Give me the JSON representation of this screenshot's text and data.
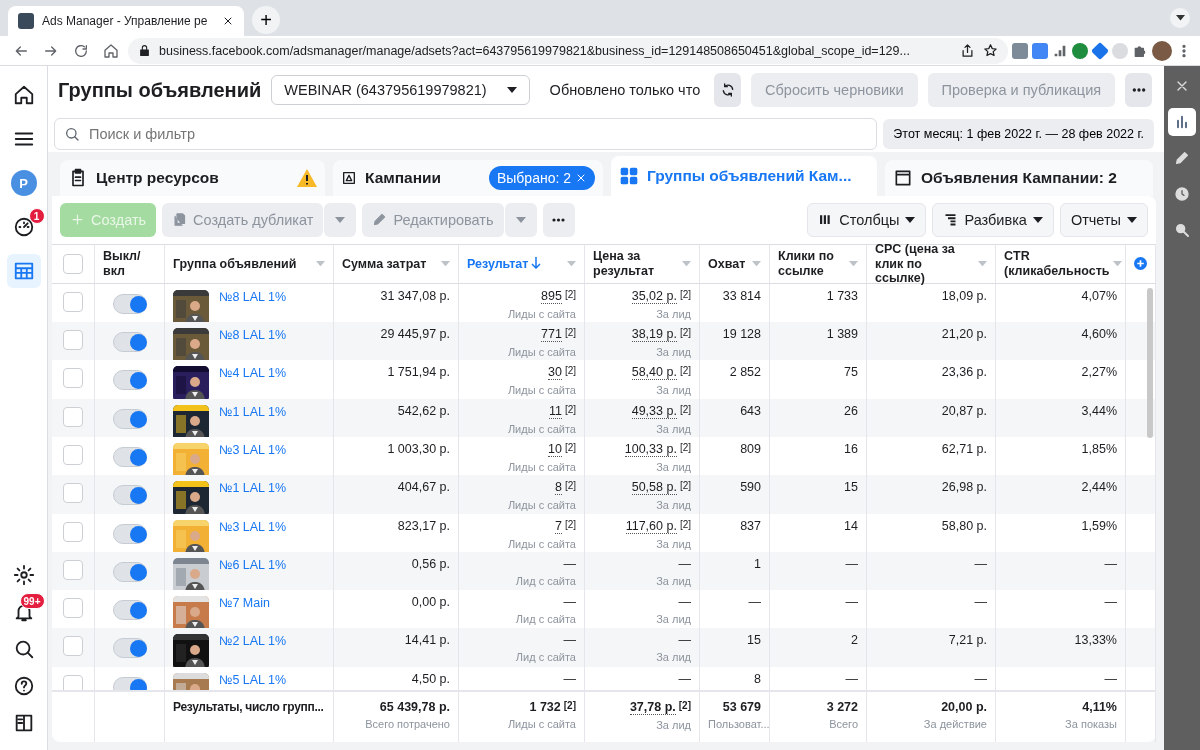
{
  "browser": {
    "tab_title": "Ads Manager - Управление ре",
    "new_tab": "+",
    "url": "business.facebook.com/adsmanager/manage/adsets?act=643795619979821&business_id=129148508650451&global_scope_id=129..."
  },
  "sidebar": {
    "items": [
      {
        "kind": "home",
        "selected": false
      },
      {
        "kind": "menu",
        "selected": false
      },
      {
        "kind": "account",
        "initial": "P",
        "selected": false
      },
      {
        "kind": "gauge",
        "badge": "1",
        "selected": false
      },
      {
        "kind": "table",
        "selected": true
      }
    ],
    "bottom_items": [
      {
        "kind": "settings",
        "selected": false
      },
      {
        "kind": "bell",
        "badge": "99+",
        "selected": false
      },
      {
        "kind": "search",
        "selected": false
      },
      {
        "kind": "help",
        "selected": false
      },
      {
        "kind": "panel",
        "selected": false
      }
    ]
  },
  "header": {
    "title": "Группы объявлений",
    "account": "WEBINAR (643795619979821)",
    "status": "Обновлено только что",
    "buttons": [
      {
        "label": "Сбросить черновики",
        "disabled": true
      },
      {
        "label": "Проверка и публикация",
        "disabled": true
      }
    ]
  },
  "search": {
    "placeholder": "Поиск и фильтр"
  },
  "date_range": "Этот месяц: 1 фев 2022 г. — 28 фев 2022 г.",
  "tabs": [
    {
      "kind": "resources",
      "label": "Центр ресурсов",
      "warning": true,
      "selected": false
    },
    {
      "kind": "campaigns",
      "label": "Кампании",
      "badge": "Выбрано: 2",
      "selected": false
    },
    {
      "kind": "adsets",
      "label": "Группы объявлений Кам...",
      "selected": true
    },
    {
      "kind": "ads",
      "label": "Объявления Кампании: 2",
      "selected": false
    }
  ],
  "toolbar": {
    "actions": [
      {
        "kind": "create",
        "label": "Создать",
        "disabled": true
      },
      {
        "kind": "duplicate",
        "label": "Создать дубликат",
        "disabled": true
      },
      {
        "kind": "edit",
        "label": "Редактировать",
        "disabled": true
      }
    ],
    "views": [
      {
        "kind": "columns",
        "label": "Столбцы"
      },
      {
        "kind": "breakdown",
        "label": "Разбивка"
      },
      {
        "kind": "reports",
        "label": "Отчеты"
      }
    ]
  },
  "table": {
    "all_selected": false,
    "columns": [
      {
        "label": "Выкл/ вкл",
        "sorted": false
      },
      {
        "label": "Группа объявлений",
        "sorted": false
      },
      {
        "label": "Сумма затрат",
        "sorted": false
      },
      {
        "label": "Результат",
        "sorted": true
      },
      {
        "label": "Цена за результат",
        "sorted": false
      },
      {
        "label": "Охват",
        "sorted": false
      },
      {
        "label": "Клики по ссылке",
        "sorted": false
      },
      {
        "label": "CPC (цена за клик по ссылке)",
        "sorted": false
      },
      {
        "label": "CTR (кликабельность",
        "sorted": false
      }
    ],
    "rows": [
      {
        "selected": false,
        "on": true,
        "name": "№8 LAL 1%",
        "spend": "31 347,08 р.",
        "result": "895",
        "result_note": "[2]",
        "result_label": "Лиды с сайта",
        "cost": "35,02 р.",
        "cost_note": "[2]",
        "cost_label": "За лид",
        "reach": "33 814",
        "clicks": "1 733",
        "cpc": "18,09 р.",
        "ctr": "4,07%"
      },
      {
        "selected": false,
        "on": true,
        "name": "№8 LAL 1%",
        "spend": "29 445,97 р.",
        "result": "771",
        "result_note": "[2]",
        "result_label": "Лиды с сайта",
        "cost": "38,19 р.",
        "cost_note": "[2]",
        "cost_label": "За лид",
        "reach": "19 128",
        "clicks": "1 389",
        "cpc": "21,20 р.",
        "ctr": "4,60%"
      },
      {
        "selected": false,
        "on": true,
        "name": "№4 LAL 1%",
        "spend": "1 751,94 р.",
        "result": "30",
        "result_note": "[2]",
        "result_label": "Лиды с сайта",
        "cost": "58,40 р.",
        "cost_note": "[2]",
        "cost_label": "За лид",
        "reach": "2 852",
        "clicks": "75",
        "cpc": "23,36 р.",
        "ctr": "2,27%"
      },
      {
        "selected": false,
        "on": true,
        "name": "№1 LAL 1%",
        "spend": "542,62 р.",
        "result": "11",
        "result_note": "[2]",
        "result_label": "Лиды с сайта",
        "cost": "49,33 р.",
        "cost_note": "[2]",
        "cost_label": "За лид",
        "reach": "643",
        "clicks": "26",
        "cpc": "20,87 р.",
        "ctr": "3,44%"
      },
      {
        "selected": false,
        "on": true,
        "name": "№3 LAL 1%",
        "spend": "1 003,30 р.",
        "result": "10",
        "result_note": "[2]",
        "result_label": "Лиды с сайта",
        "cost": "100,33 р.",
        "cost_note": "[2]",
        "cost_label": "За лид",
        "reach": "809",
        "clicks": "16",
        "cpc": "62,71 р.",
        "ctr": "1,85%"
      },
      {
        "selected": false,
        "on": true,
        "name": "№1 LAL 1%",
        "spend": "404,67 р.",
        "result": "8",
        "result_note": "[2]",
        "result_label": "Лиды с сайта",
        "cost": "50,58 р.",
        "cost_note": "[2]",
        "cost_label": "За лид",
        "reach": "590",
        "clicks": "15",
        "cpc": "26,98 р.",
        "ctr": "2,44%"
      },
      {
        "selected": false,
        "on": true,
        "name": "№3 LAL 1%",
        "spend": "823,17 р.",
        "result": "7",
        "result_note": "[2]",
        "result_label": "Лиды с сайта",
        "cost": "117,60 р.",
        "cost_note": "[2]",
        "cost_label": "За лид",
        "reach": "837",
        "clicks": "14",
        "cpc": "58,80 р.",
        "ctr": "1,59%"
      },
      {
        "selected": false,
        "on": true,
        "name": "№6 LAL 1%",
        "spend": "0,56 р.",
        "result": "—",
        "result_label": "Лид с сайта",
        "cost": "—",
        "cost_label": "За лид",
        "reach": "1",
        "clicks": "—",
        "cpc": "—",
        "ctr": "—"
      },
      {
        "selected": false,
        "on": true,
        "name": "№7 Main",
        "spend": "0,00 р.",
        "result": "—",
        "result_label": "Лид с сайта",
        "cost": "—",
        "cost_label": "За лид",
        "reach": "—",
        "clicks": "—",
        "cpc": "—",
        "ctr": "—"
      },
      {
        "selected": false,
        "on": true,
        "name": "№2 LAL 1%",
        "spend": "14,41 р.",
        "result": "—",
        "result_label": "Лид с сайта",
        "cost": "—",
        "cost_label": "За лид",
        "reach": "15",
        "clicks": "2",
        "cpc": "7,21 р.",
        "ctr": "13,33%"
      },
      {
        "selected": false,
        "on": true,
        "name": "№5 LAL 1%",
        "spend": "4,50 р.",
        "result": "—",
        "cost": "—",
        "reach": "8",
        "clicks": "—",
        "cpc": "—",
        "ctr": "—"
      }
    ],
    "footer": {
      "label": "Результаты, число групп...",
      "spend": "65 439,78 р.",
      "spend_label": "Всего потрачено",
      "result": "1 732",
      "result_note": "[2]",
      "result_label": "Лиды с сайта",
      "cost": "37,78 р.",
      "cost_note": "[2]",
      "cost_label": "За лид",
      "reach": "53 679",
      "reach_label": "Пользоват...",
      "clicks": "3 272",
      "clicks_label": "Всего",
      "cpc": "20,00 р.",
      "cpc_label": "За действие",
      "ctr": "4,11%",
      "ctr_label": "За показы"
    }
  },
  "right_panel": {
    "items": [
      {
        "kind": "close",
        "selected": false
      },
      {
        "kind": "chart",
        "selected": true
      },
      {
        "kind": "pencil",
        "selected": false
      },
      {
        "kind": "clock",
        "selected": false
      },
      {
        "kind": "zoom",
        "selected": false
      }
    ]
  }
}
